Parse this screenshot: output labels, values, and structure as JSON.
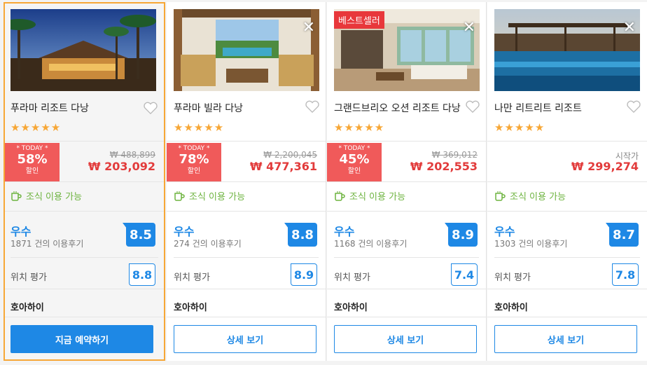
{
  "colors": {
    "accent": "#1e88e5",
    "discount": "#f05a5a",
    "price": "#e23b3b",
    "star": "#f7a736",
    "breakfast": "#6db33f",
    "selected_border": "#f7a736"
  },
  "cards": [
    {
      "name": "푸라마 리조트 다낭",
      "stars": "★★★★★",
      "today_label": "* TODAY *",
      "discount": "58%",
      "discount_unit": "할인",
      "original_price": "₩ 488,899",
      "price": "₩ 203,092",
      "breakfast": "조식 이용 가능",
      "rating_word": "우수",
      "reviews": "1871 건의 이용후기",
      "score": "8.5",
      "location_label": "위치 평가",
      "location_score": "8.8",
      "city": "호아하이",
      "button": "지금 예약하기"
    },
    {
      "name": "푸라마 빌라 다낭",
      "stars": "★★★★★",
      "today_label": "* TODAY *",
      "discount": "78%",
      "discount_unit": "할인",
      "original_price": "₩ 2,200,045",
      "price": "₩ 477,361",
      "breakfast": "조식 이용 가능",
      "rating_word": "우수",
      "reviews": "274 건의 이용후기",
      "score": "8.8",
      "location_label": "위치 평가",
      "location_score": "8.9",
      "city": "호아하이",
      "button": "상세 보기"
    },
    {
      "badge": "베스트셀러",
      "name": "그랜드브리오 오션 리조트 다낭",
      "stars": "★★★★★",
      "today_label": "* TODAY *",
      "discount": "45%",
      "discount_unit": "할인",
      "original_price": "₩ 369,012",
      "price": "₩ 202,553",
      "breakfast": "조식 이용 가능",
      "rating_word": "우수",
      "reviews": "1168 건의 이용후기",
      "score": "8.9",
      "location_label": "위치 평가",
      "location_score": "7.4",
      "city": "호아하이",
      "button": "상세 보기"
    },
    {
      "name": "나만 리트리트 리조트",
      "stars": "★★★★★",
      "price_label": "시작가",
      "price": "₩ 299,274",
      "breakfast": "조식 이용 가능",
      "rating_word": "우수",
      "reviews": "1303 건의 이용후기",
      "score": "8.7",
      "location_label": "위치 평가",
      "location_score": "7.8",
      "city": "호아하이",
      "button": "상세 보기"
    }
  ]
}
